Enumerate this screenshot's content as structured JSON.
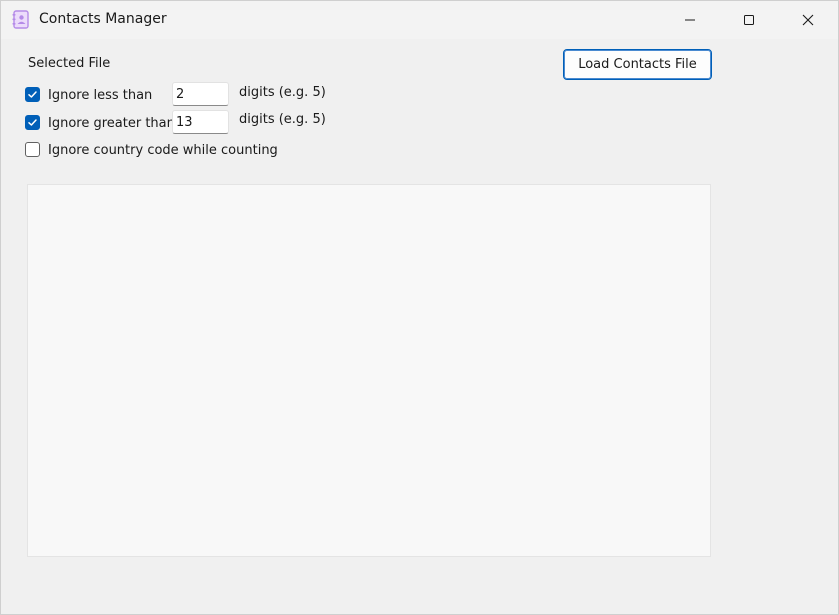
{
  "window": {
    "title": "Contacts Manager",
    "icon": "address-book-icon",
    "controls": [
      "minimize-icon",
      "maximize-icon",
      "close-icon"
    ]
  },
  "form": {
    "selected_file_label": "Selected File",
    "load_button_label": "Load Contacts File",
    "ignore_less": {
      "checked": true,
      "label": "Ignore less than",
      "value": "2",
      "suffix": "digits (e.g. 5)"
    },
    "ignore_greater": {
      "checked": true,
      "label": "Ignore greater than",
      "value": "13",
      "suffix": "digits (e.g. 5)"
    },
    "ignore_country_code": {
      "checked": false,
      "label": "Ignore country code while counting"
    }
  },
  "colors": {
    "accent": "#005fb8",
    "window_bg": "#f0f0f0",
    "panel_bg": "#f8f8f8",
    "icon_purple": "#b58be8"
  }
}
